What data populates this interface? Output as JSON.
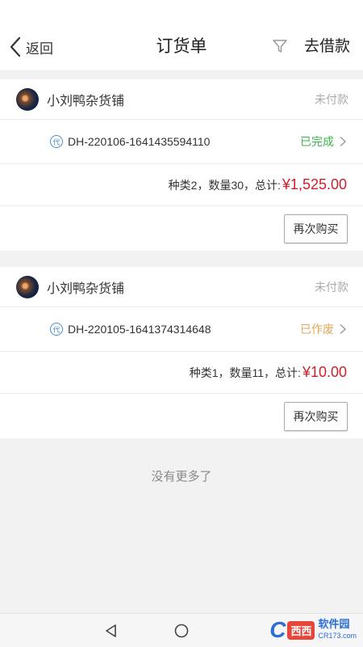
{
  "nav": {
    "back_label": "返回",
    "title": "订货单",
    "borrow_label": "去借款"
  },
  "orders": [
    {
      "shop_name": "小刘鸭杂货铺",
      "pay_status": "未付款",
      "badge": "代",
      "order_no": "DH-220106-1641435594110",
      "status": "已完成",
      "summary": "种类2，数量30，总计:",
      "total": "¥1,525.00",
      "action": "再次购买"
    },
    {
      "shop_name": "小刘鸭杂货铺",
      "pay_status": "未付款",
      "badge": "代",
      "order_no": "DH-220105-1641374314648",
      "status": "已作废",
      "summary": "种类1，数量11，总计:",
      "total": "¥10.00",
      "action": "再次购买"
    }
  ],
  "footer": {
    "no_more": "没有更多了"
  },
  "watermark": {
    "logo": "C",
    "badge": "西西",
    "title": "软件园",
    "sub": "CR173.com"
  },
  "colors": {
    "status_done": "#3bb54a",
    "status_void": "#e0a85c",
    "total_red": "#d0202a",
    "badge_blue": "#4a90c8"
  }
}
